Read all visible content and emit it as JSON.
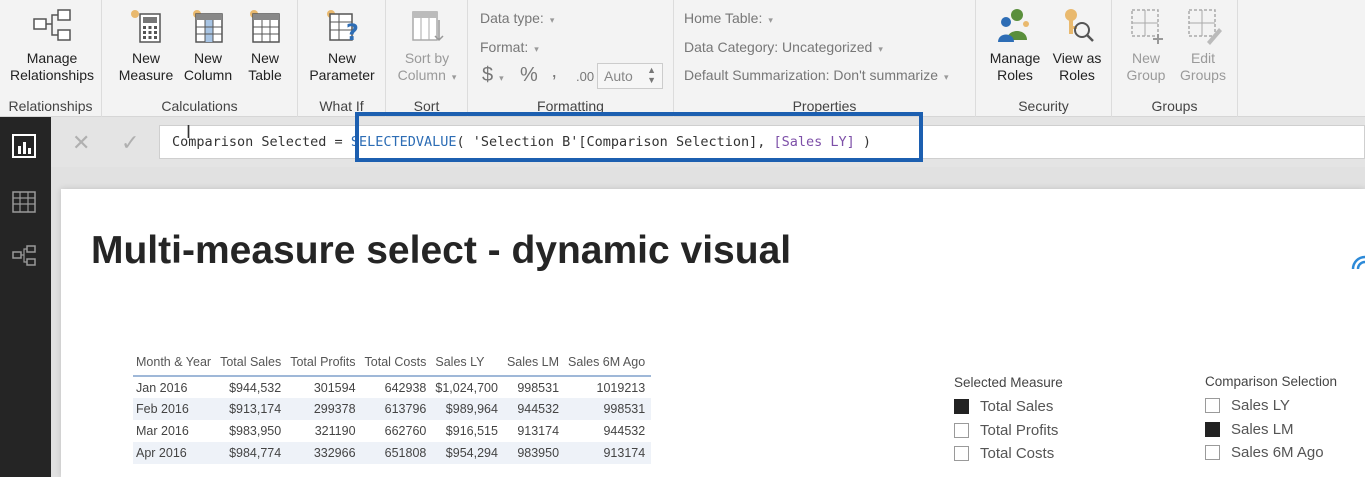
{
  "ribbon": {
    "relationships": {
      "button": "Manage\nRelationships",
      "label": "Relationships"
    },
    "calculations": {
      "new_measure": "New\nMeasure",
      "new_column": "New\nColumn",
      "new_table": "New\nTable",
      "label": "Calculations"
    },
    "whatif": {
      "new_parameter": "New\nParameter",
      "label": "What If"
    },
    "sort": {
      "sort_by_column": "Sort by\nColumn",
      "label": "Sort"
    },
    "formatting": {
      "data_type": "Data type:",
      "format": "Format:",
      "currency": "$",
      "percent": "%",
      "comma": "‚",
      "decimals": ".00",
      "auto": "Auto",
      "label": "Formatting"
    },
    "properties": {
      "home_table": "Home Table:",
      "data_category": "Data Category: Uncategorized",
      "default_summarization": "Default Summarization: Don't summarize",
      "label": "Properties"
    },
    "security": {
      "manage_roles": "Manage\nRoles",
      "view_as_roles": "View as\nRoles",
      "label": "Security"
    },
    "groups": {
      "new_group": "New\nGroup",
      "edit_groups": "Edit\nGroups",
      "label": "Groups"
    }
  },
  "formula": {
    "prefix": "Comparison Selected = ",
    "function": "SELECTEDVALUE",
    "open": "( ",
    "argument": "'Selection B'[Comparison Selection], ",
    "measure": "[Sales LY]",
    "close": " )",
    "cancel_icon": "close-icon",
    "commit_icon": "check-icon"
  },
  "report": {
    "title": "Multi-measure select - dynamic visual",
    "table": {
      "columns": [
        "Month & Year",
        "Total Sales",
        "Total Profits",
        "Total Costs",
        "Sales LY",
        "Sales LM",
        "Sales 6M Ago"
      ],
      "rows": [
        [
          "Jan 2016",
          "$944,532",
          "301594",
          "642938",
          "$1,024,700",
          "998531",
          "1019213"
        ],
        [
          "Feb 2016",
          "$913,174",
          "299378",
          "613796",
          "$989,964",
          "944532",
          "998531"
        ],
        [
          "Mar 2016",
          "$983,950",
          "321190",
          "662760",
          "$916,515",
          "913174",
          "944532"
        ],
        [
          "Apr 2016",
          "$984,774",
          "332966",
          "651808",
          "$954,294",
          "983950",
          "913174"
        ]
      ]
    },
    "selected_measure": {
      "title": "Selected Measure",
      "items": [
        {
          "label": "Total Sales",
          "checked": true
        },
        {
          "label": "Total Profits",
          "checked": false
        },
        {
          "label": "Total Costs",
          "checked": false
        }
      ]
    },
    "comparison_selection": {
      "title": "Comparison Selection",
      "items": [
        {
          "label": "Sales LY",
          "checked": false
        },
        {
          "label": "Sales LM",
          "checked": true
        },
        {
          "label": "Sales 6M Ago",
          "checked": false
        }
      ]
    }
  },
  "colors": {
    "highlight_border": "#1c5fb0",
    "dax_keyword": "#2d6db5",
    "dax_measure": "#7d4fa8",
    "rail": "#252525"
  }
}
